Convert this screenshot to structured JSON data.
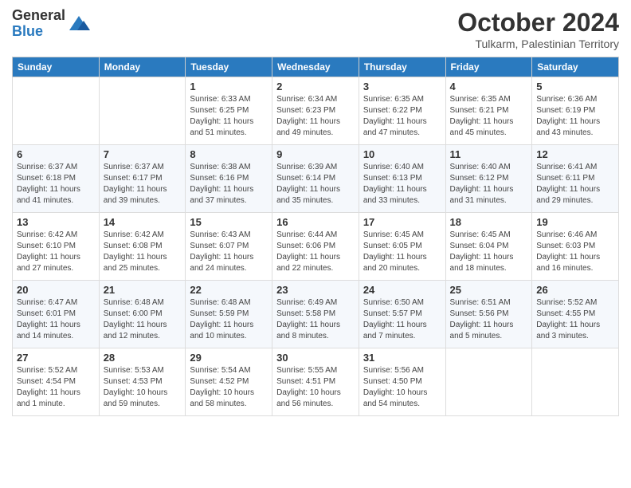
{
  "logo": {
    "general": "General",
    "blue": "Blue"
  },
  "header": {
    "month": "October 2024",
    "location": "Tulkarm, Palestinian Territory"
  },
  "weekdays": [
    "Sunday",
    "Monday",
    "Tuesday",
    "Wednesday",
    "Thursday",
    "Friday",
    "Saturday"
  ],
  "weeks": [
    [
      {
        "day": "",
        "info": ""
      },
      {
        "day": "",
        "info": ""
      },
      {
        "day": "1",
        "info": "Sunrise: 6:33 AM\nSunset: 6:25 PM\nDaylight: 11 hours and 51 minutes."
      },
      {
        "day": "2",
        "info": "Sunrise: 6:34 AM\nSunset: 6:23 PM\nDaylight: 11 hours and 49 minutes."
      },
      {
        "day": "3",
        "info": "Sunrise: 6:35 AM\nSunset: 6:22 PM\nDaylight: 11 hours and 47 minutes."
      },
      {
        "day": "4",
        "info": "Sunrise: 6:35 AM\nSunset: 6:21 PM\nDaylight: 11 hours and 45 minutes."
      },
      {
        "day": "5",
        "info": "Sunrise: 6:36 AM\nSunset: 6:19 PM\nDaylight: 11 hours and 43 minutes."
      }
    ],
    [
      {
        "day": "6",
        "info": "Sunrise: 6:37 AM\nSunset: 6:18 PM\nDaylight: 11 hours and 41 minutes."
      },
      {
        "day": "7",
        "info": "Sunrise: 6:37 AM\nSunset: 6:17 PM\nDaylight: 11 hours and 39 minutes."
      },
      {
        "day": "8",
        "info": "Sunrise: 6:38 AM\nSunset: 6:16 PM\nDaylight: 11 hours and 37 minutes."
      },
      {
        "day": "9",
        "info": "Sunrise: 6:39 AM\nSunset: 6:14 PM\nDaylight: 11 hours and 35 minutes."
      },
      {
        "day": "10",
        "info": "Sunrise: 6:40 AM\nSunset: 6:13 PM\nDaylight: 11 hours and 33 minutes."
      },
      {
        "day": "11",
        "info": "Sunrise: 6:40 AM\nSunset: 6:12 PM\nDaylight: 11 hours and 31 minutes."
      },
      {
        "day": "12",
        "info": "Sunrise: 6:41 AM\nSunset: 6:11 PM\nDaylight: 11 hours and 29 minutes."
      }
    ],
    [
      {
        "day": "13",
        "info": "Sunrise: 6:42 AM\nSunset: 6:10 PM\nDaylight: 11 hours and 27 minutes."
      },
      {
        "day": "14",
        "info": "Sunrise: 6:42 AM\nSunset: 6:08 PM\nDaylight: 11 hours and 25 minutes."
      },
      {
        "day": "15",
        "info": "Sunrise: 6:43 AM\nSunset: 6:07 PM\nDaylight: 11 hours and 24 minutes."
      },
      {
        "day": "16",
        "info": "Sunrise: 6:44 AM\nSunset: 6:06 PM\nDaylight: 11 hours and 22 minutes."
      },
      {
        "day": "17",
        "info": "Sunrise: 6:45 AM\nSunset: 6:05 PM\nDaylight: 11 hours and 20 minutes."
      },
      {
        "day": "18",
        "info": "Sunrise: 6:45 AM\nSunset: 6:04 PM\nDaylight: 11 hours and 18 minutes."
      },
      {
        "day": "19",
        "info": "Sunrise: 6:46 AM\nSunset: 6:03 PM\nDaylight: 11 hours and 16 minutes."
      }
    ],
    [
      {
        "day": "20",
        "info": "Sunrise: 6:47 AM\nSunset: 6:01 PM\nDaylight: 11 hours and 14 minutes."
      },
      {
        "day": "21",
        "info": "Sunrise: 6:48 AM\nSunset: 6:00 PM\nDaylight: 11 hours and 12 minutes."
      },
      {
        "day": "22",
        "info": "Sunrise: 6:48 AM\nSunset: 5:59 PM\nDaylight: 11 hours and 10 minutes."
      },
      {
        "day": "23",
        "info": "Sunrise: 6:49 AM\nSunset: 5:58 PM\nDaylight: 11 hours and 8 minutes."
      },
      {
        "day": "24",
        "info": "Sunrise: 6:50 AM\nSunset: 5:57 PM\nDaylight: 11 hours and 7 minutes."
      },
      {
        "day": "25",
        "info": "Sunrise: 6:51 AM\nSunset: 5:56 PM\nDaylight: 11 hours and 5 minutes."
      },
      {
        "day": "26",
        "info": "Sunrise: 5:52 AM\nSunset: 4:55 PM\nDaylight: 11 hours and 3 minutes."
      }
    ],
    [
      {
        "day": "27",
        "info": "Sunrise: 5:52 AM\nSunset: 4:54 PM\nDaylight: 11 hours and 1 minute."
      },
      {
        "day": "28",
        "info": "Sunrise: 5:53 AM\nSunset: 4:53 PM\nDaylight: 10 hours and 59 minutes."
      },
      {
        "day": "29",
        "info": "Sunrise: 5:54 AM\nSunset: 4:52 PM\nDaylight: 10 hours and 58 minutes."
      },
      {
        "day": "30",
        "info": "Sunrise: 5:55 AM\nSunset: 4:51 PM\nDaylight: 10 hours and 56 minutes."
      },
      {
        "day": "31",
        "info": "Sunrise: 5:56 AM\nSunset: 4:50 PM\nDaylight: 10 hours and 54 minutes."
      },
      {
        "day": "",
        "info": ""
      },
      {
        "day": "",
        "info": ""
      }
    ]
  ]
}
